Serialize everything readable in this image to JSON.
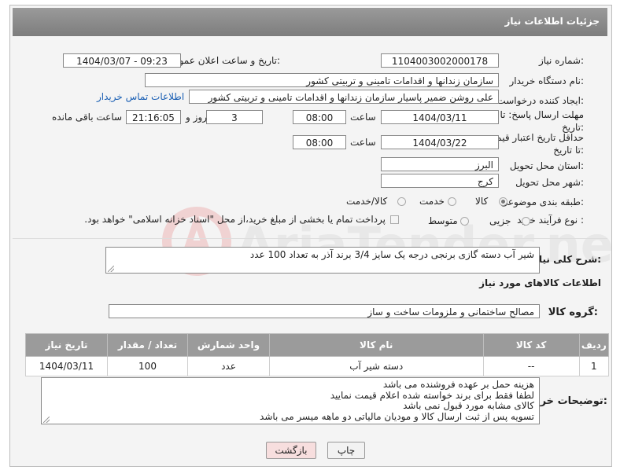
{
  "header": {
    "title": "جزئیات اطلاعات نیاز"
  },
  "form": {
    "need_number_label": "شماره نیاز:",
    "need_number": "1104003002000178",
    "announce_label": "تاریخ و ساعت اعلان عمومی:",
    "announce_value": "1404/03/07 - 09:23",
    "buyer_org_label": "نام دستگاه خریدار:",
    "buyer_org": "سازمان زندانها و اقدامات تامینی و تربیتی کشور",
    "creator_label": "ایجاد کننده درخواست:",
    "creator": "علی روشن ضمیر پاسیار سازمان زندانها و اقدامات تامینی و تربیتی کشور",
    "contact_link": "اطلاعات تماس خریدار",
    "reply_deadline_label": "مهلت ارسال پاسخ: تا تاریخ:",
    "reply_date": "1404/03/11",
    "time_label": "ساعت",
    "reply_time": "08:00",
    "days_value": "3",
    "days_label": "روز و",
    "remaining_time": "21:16:05",
    "remaining_label": "ساعت باقی مانده",
    "validity_label": "حداقل تاریخ اعتبار قیمت: تا تاریخ:",
    "validity_date": "1404/03/22",
    "validity_time": "08:00",
    "province_label": "استان محل تحویل:",
    "province": "البرز",
    "city_label": "شهر محل تحویل:",
    "city": "کرج",
    "category_label": "طبقه بندی موضوعی:",
    "category_options": [
      "کالا",
      "خدمت",
      "کالا/خدمت"
    ],
    "purchase_type_label": "نوع فرآیند خرید :",
    "purchase_options": [
      "جزیی",
      "متوسط"
    ],
    "payment_note": "پرداخت تمام یا بخشی از مبلغ خرید،از محل \"اسناد خزانه اسلامی\" خواهد بود."
  },
  "description": {
    "label": "شرح کلی نیاز:",
    "text": "شیر آب دسته گازی برنجی درجه یک سایز 3/4 برند آذر به تعداد 100 عدد"
  },
  "goods": {
    "section_title": "اطلاعات کالاهای مورد نیاز",
    "group_label": "گروه کالا:",
    "group_value": "مصالح ساختمانی و ملزومات ساخت و ساز",
    "columns": [
      "ردیف",
      "کد کالا",
      "نام کالا",
      "واحد شمارش",
      "تعداد / مقدار",
      "تاریخ نیاز"
    ],
    "rows": [
      {
        "index": "1",
        "code": "--",
        "name": "دسته شیر آب",
        "unit": "عدد",
        "qty": "100",
        "date": "1404/03/11"
      }
    ]
  },
  "buyer_notes": {
    "label": "توضیحات خریدار:",
    "lines": [
      "هزینه حمل بر عهده فروشنده می باشد",
      "لطفا فقط برای برند خواسته شده اعلام قیمت نمایید",
      "کالای مشابه مورد قبول نمی باشد",
      "تسویه پس از ثبت ارسال کالا و مودیان مالیاتی دو ماهه میسر می باشد"
    ]
  },
  "buttons": {
    "print": "چاپ",
    "back": "بازگشت"
  },
  "watermark": {
    "text": "AriaTender.net"
  },
  "colors": {
    "header": "#8a8a8a",
    "link": "#1a5fb4",
    "back_button": "#f7dede"
  }
}
